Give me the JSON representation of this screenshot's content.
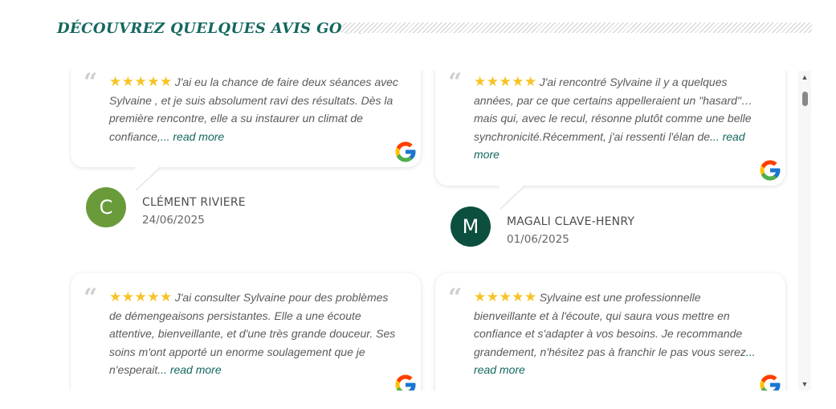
{
  "header": {
    "title": "DÉCOUVREZ QUELQUES AVIS GOOGLE"
  },
  "icons": {
    "quote": "quote-icon",
    "stars": "five-star-rating-icon",
    "source": "google-g-icon",
    "scroll_up": "scroll-up-arrow-icon",
    "scroll_down": "scroll-down-arrow-icon"
  },
  "colors": {
    "accent": "#14675f",
    "star": "#f7c325",
    "avatar_1": "#6a9b3b",
    "avatar_2": "#0c4f3f"
  },
  "reviews": [
    {
      "stars": "★★★★★",
      "text": "J'ai eu la chance de faire deux séances avec Sylvaine , et je suis absolument ravi des résultats. Dès la première rencontre, elle a su instaurer un climat de confiance,",
      "more": "... read more",
      "initial": "C",
      "name": "CLÉMENT RIVIERE",
      "date": "24/06/2025"
    },
    {
      "stars": "★★★★★",
      "text": "J'ai rencontré Sylvaine il y a quelques années, par ce que certains appelleraient un \"hasard\"… mais qui, avec le recul, résonne plutôt comme une belle synchronicité.Récemment, j'ai ressenti l'élan de",
      "more": "... read more",
      "initial": "M",
      "name": "MAGALI CLAVE-HENRY",
      "date": "01/06/2025"
    },
    {
      "stars": "★★★★★",
      "text": "J'ai consulter Sylvaine pour des problèmes de démengeaisons persistantes. Elle a une écoute attentive, bienveillante, et d'une très grande douceur. Ses soins m'ont apporté un enorme soulagement que je n'esperait",
      "more": "... read more"
    },
    {
      "stars": "★★★★★",
      "text": "Sylvaine est une professionnelle bienveillante et à l'écoute, qui saura vous mettre en confiance et s'adapter à vos besoins. Je recommande grandement, n'hésitez pas à franchir le pas vous serez",
      "more": "... read more"
    }
  ],
  "scrollbar": {
    "up": "▲",
    "down": "▼"
  }
}
